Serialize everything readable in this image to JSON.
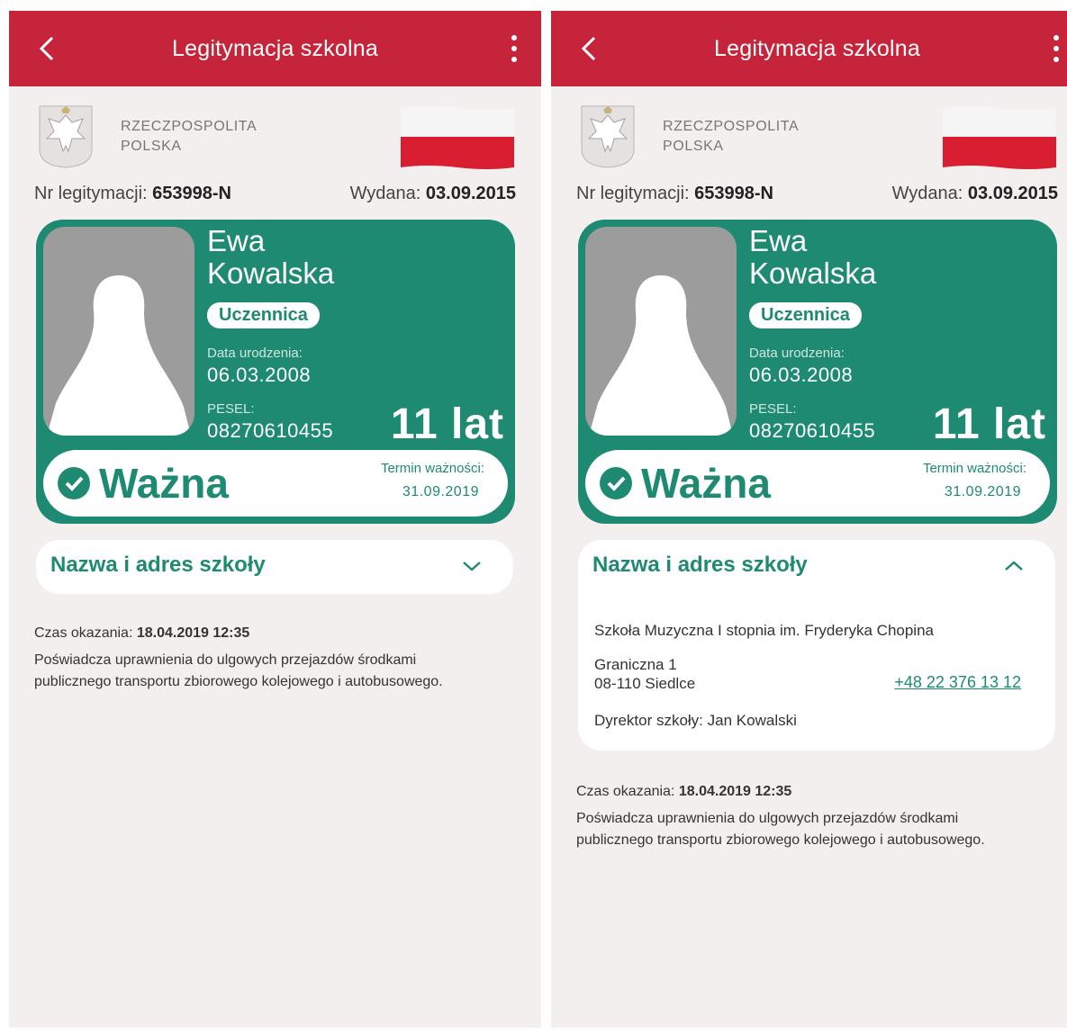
{
  "appbar": {
    "title": "Legitymacja szkolna"
  },
  "header": {
    "country_line1": "RZECZPOSPOLITA",
    "country_line2": "POLSKA"
  },
  "meta": {
    "nr_label": "Nr legitymacji:",
    "nr_value": "653998-N",
    "issued_label": "Wydana:",
    "issued_value": "03.09.2015"
  },
  "card": {
    "first_name": "Ewa",
    "last_name": "Kowalska",
    "role_badge": "Uczennica",
    "dob_label": "Data urodzenia:",
    "dob_value": "06.03.2008",
    "pesel_label": "PESEL:",
    "pesel_value": "08270610455",
    "age": "11 lat",
    "status": "Ważna",
    "validity_label": "Termin ważności:",
    "validity_value": "31.09.2019"
  },
  "school_section": {
    "title": "Nazwa i adres szkoły",
    "name": "Szkoła Muzyczna I stopnia im. Fryderyka Chopina",
    "street": "Graniczna 1",
    "city": "08-110 Siedlce",
    "phone": "+48 22 376 13 12",
    "director_label": "Dyrektor szkoły:",
    "director_name": "Jan Kowalski"
  },
  "footer": {
    "time_label": "Czas okazania:",
    "time_value": "18.04.2019 12:35",
    "note_line1": "Poświadcza uprawnienia do ulgowych przejazdów środkami",
    "note_line2": "publicznego transportu zbiorowego kolejowego i autobusowego."
  },
  "colors": {
    "appbar": "#c6243a",
    "card": "#1f8a72",
    "background": "#f3efef"
  },
  "icons": [
    "back-arrow-icon",
    "more-vert-icon",
    "eagle-emblem-icon",
    "poland-flag-icon",
    "check-circle-icon",
    "chevron-down-icon",
    "chevron-up-icon"
  ]
}
